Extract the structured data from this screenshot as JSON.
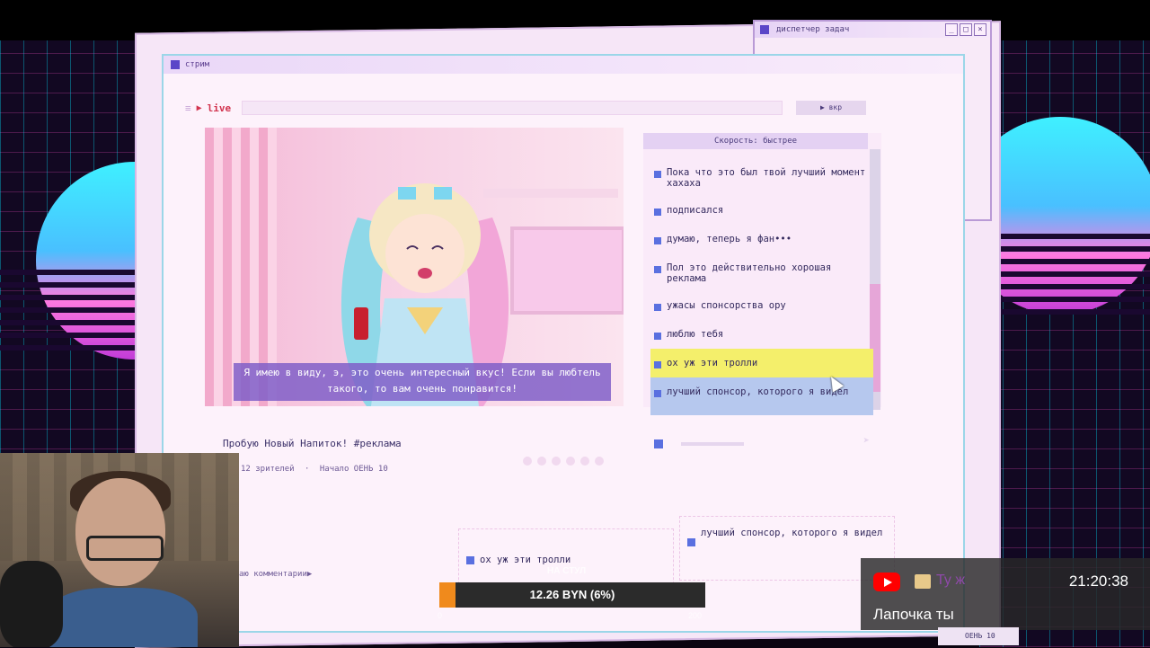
{
  "taskmanager": {
    "title": "диспетчер задач"
  },
  "stream_window": {
    "title": "стрим",
    "live_label": "live",
    "exit_label": "вкр",
    "caption": "Я имею в виду, э, это очень интересный вкус! Если вы любтель такого, то вам очень понравится!",
    "stream_title": "Пробую Новый Напиток! #реклама",
    "viewers": "12 зрителей",
    "start": "Начало ОЕНЬ 10"
  },
  "chat": {
    "speed_label": "Скорость: быстрее",
    "messages": [
      {
        "text": "Пока что это был твой лучший момент хахаха",
        "state": "normal"
      },
      {
        "text": "подписался",
        "state": "normal"
      },
      {
        "text": "думаю, теперь я фан•••",
        "state": "normal"
      },
      {
        "text": "Пол это действительно хорошая реклама",
        "state": "normal"
      },
      {
        "text": "ужасы спонсорства ору",
        "state": "normal"
      },
      {
        "text": "люблю тебя",
        "state": "normal"
      },
      {
        "text": "ох уж эти тролли",
        "state": "highlight"
      },
      {
        "text": "лучший спонсор, которого я видел",
        "state": "selected"
      }
    ]
  },
  "comments": {
    "left": "ох уж эти тролли",
    "right": "лучший спонсор, которого я видел",
    "label": "аю комментарии▶"
  },
  "donation": {
    "title": "НА СТУЛ",
    "amount": "12.26 BYN (6%)",
    "progress_fraction": 0.06,
    "scale_min": "0",
    "scale_max": "200"
  },
  "youtube": {
    "channel": "Ту ж",
    "message": "Лапочка ты",
    "clock": "21:20:38"
  },
  "taskbar": {
    "day": "ОЕНЬ 10"
  },
  "colors": {
    "accent": "#5b46c8",
    "highlight": "#f4ef6b",
    "selected": "#b6c8ee",
    "live": "#d2344f"
  }
}
